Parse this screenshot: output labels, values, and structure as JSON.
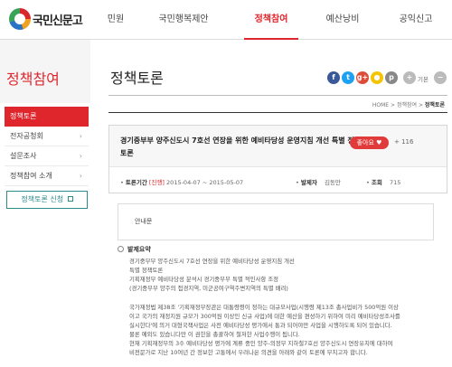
{
  "header": {
    "logo_text": "국민신문고",
    "nav": [
      "민원",
      "국민행복제안",
      "정책참여",
      "예산낭비",
      "공익신고"
    ],
    "active_index": 2
  },
  "sidebar": {
    "title": "정책참여",
    "items": [
      {
        "label": "정책토론",
        "active": true
      },
      {
        "label": "전자공청회"
      },
      {
        "label": "설문조사"
      },
      {
        "label": "정책참여 소개"
      }
    ],
    "propose_button": "정책토론 신청"
  },
  "main": {
    "page_title": "정책토론",
    "social": {
      "icons": [
        "facebook-icon",
        "twitter-icon",
        "google-plus-icon",
        "kakao-icon",
        "print-icon",
        "zoom-in-icon",
        "zoom-out-icon"
      ],
      "glyphs": [
        "f",
        "t",
        "g+",
        "●",
        "p",
        "+",
        "−"
      ],
      "colors": [
        "#3b5998",
        "#1da1f2",
        "#dd4b39",
        "#f4c400",
        "#888888",
        "#bbbbbb",
        "#bbbbbb"
      ],
      "label": "기본"
    },
    "breadcrumb": {
      "home": "HOME",
      "sep": ">",
      "parent": "정책참여",
      "current": "정책토론"
    },
    "post": {
      "title": "경기중부부 양주신도시 7호선 연장을 위한 예비타당성 운영지침 개선 특별 정책토론",
      "like_label": "좋아요",
      "like_count": "+ 116",
      "period_label": "토론기간",
      "status": "[진행]",
      "period": "2015-04-07 ~ 2015-05-07",
      "writer_label": "발제자",
      "writer": "김동만",
      "views_label": "조회",
      "views": "715"
    },
    "notice_label": "안내문",
    "section_title": "발제요약",
    "summary_lines": [
      "경기중부부 양주신도시 7호선 연장을 위한 예비타당성 운영지침 개선",
      "특별 정책토론",
      "기획재정부 예비타당성 분석시 경기중부부 특별 적인사항 조정",
      "(경기중부부 양주의 접경지역, 미군공여구역주변지역의 특별 배려)",
      "",
      "국가재정법 제38조 '기획재정부장관은 대통령령이 정하는 대규모사업(시행령 제13조 총사업비가 500억원 이상",
      "이고 국가의 재정지원 규모가 300억원 이상인 신규 사업)에 대한 예산을 편성하기 위하여 미리 예비타당성조사를",
      "실시한다'에 의거 대형국책사업은 사전 예비타당성 평가에서 통과 되어야만 사업을 시행하도록 되어 있습니다.",
      "물론 예외도 있습니다만 이 권한을 총괄하여 철저한 사업수행이 됩니다.",
      "현재 기획재정부의 3수 예비타당성 평가에 계류 중인 양주-의정부 지하철7호선 양주신도시 연장유치에 대하여",
      "비전문가로 지난 10여년 간 정보한 고통에서 우려나온 의견을 아래와 같이 토론에 부치고자 합니다."
    ]
  }
}
